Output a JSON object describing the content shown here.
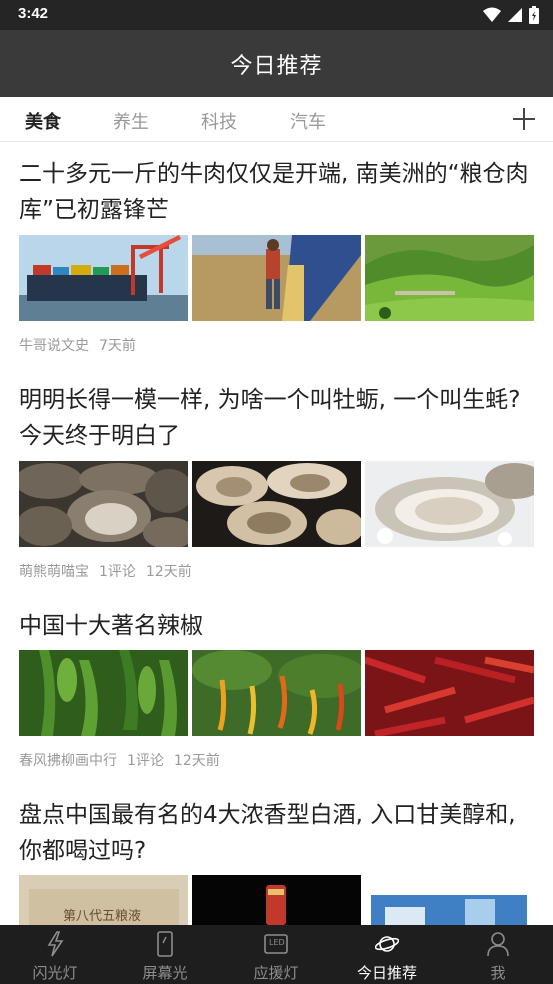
{
  "status_bar": {
    "time": "3:42"
  },
  "header": {
    "title": "今日推荐"
  },
  "tabs": [
    {
      "label": "美食",
      "active": true
    },
    {
      "label": "养生",
      "active": false
    },
    {
      "label": "科技",
      "active": false
    },
    {
      "label": "汽车",
      "active": false
    }
  ],
  "articles": [
    {
      "title": "二十多元一斤的牛肉仅仅是开端, 南美洲的“粮仓肉库”已初露锋芒",
      "source": "牛哥说文史",
      "comments": "",
      "time": "7天前",
      "images": [
        "cargo-ship-port",
        "grain-harvest",
        "green-pasture"
      ]
    },
    {
      "title": "明明长得一模一样, 为啥一个叫牡蛎, 一个叫生蚝? 今天终于明白了",
      "source": "萌熊萌喵宝",
      "comments": "1评论",
      "time": "12天前",
      "images": [
        "grilled-oysters",
        "raw-oysters",
        "oyster-on-ice"
      ]
    },
    {
      "title": "中国十大著名辣椒",
      "source": "春风拂柳画中行",
      "comments": "1评论",
      "time": "12天前",
      "images": [
        "green-peppers",
        "pepper-plants",
        "red-chilies"
      ]
    },
    {
      "title": "盘点中国最有名的4大浓香型白酒, 入口甘美醇和, 你都喝过吗?",
      "source": "",
      "comments": "",
      "time": "",
      "images": [
        "liquor-box",
        "liquor-bottle",
        "liquor-gift-set"
      ],
      "image_text": [
        "第八代五粮液",
        "LED"
      ]
    }
  ],
  "bottom_nav": [
    {
      "label": "闪光灯",
      "icon": "flash-icon",
      "active": false
    },
    {
      "label": "屏幕光",
      "icon": "phone-screen-icon",
      "active": false
    },
    {
      "label": "应援灯",
      "icon": "led-icon",
      "active": false
    },
    {
      "label": "今日推荐",
      "icon": "planet-icon",
      "active": true
    },
    {
      "label": "我",
      "icon": "user-icon",
      "active": false
    }
  ]
}
